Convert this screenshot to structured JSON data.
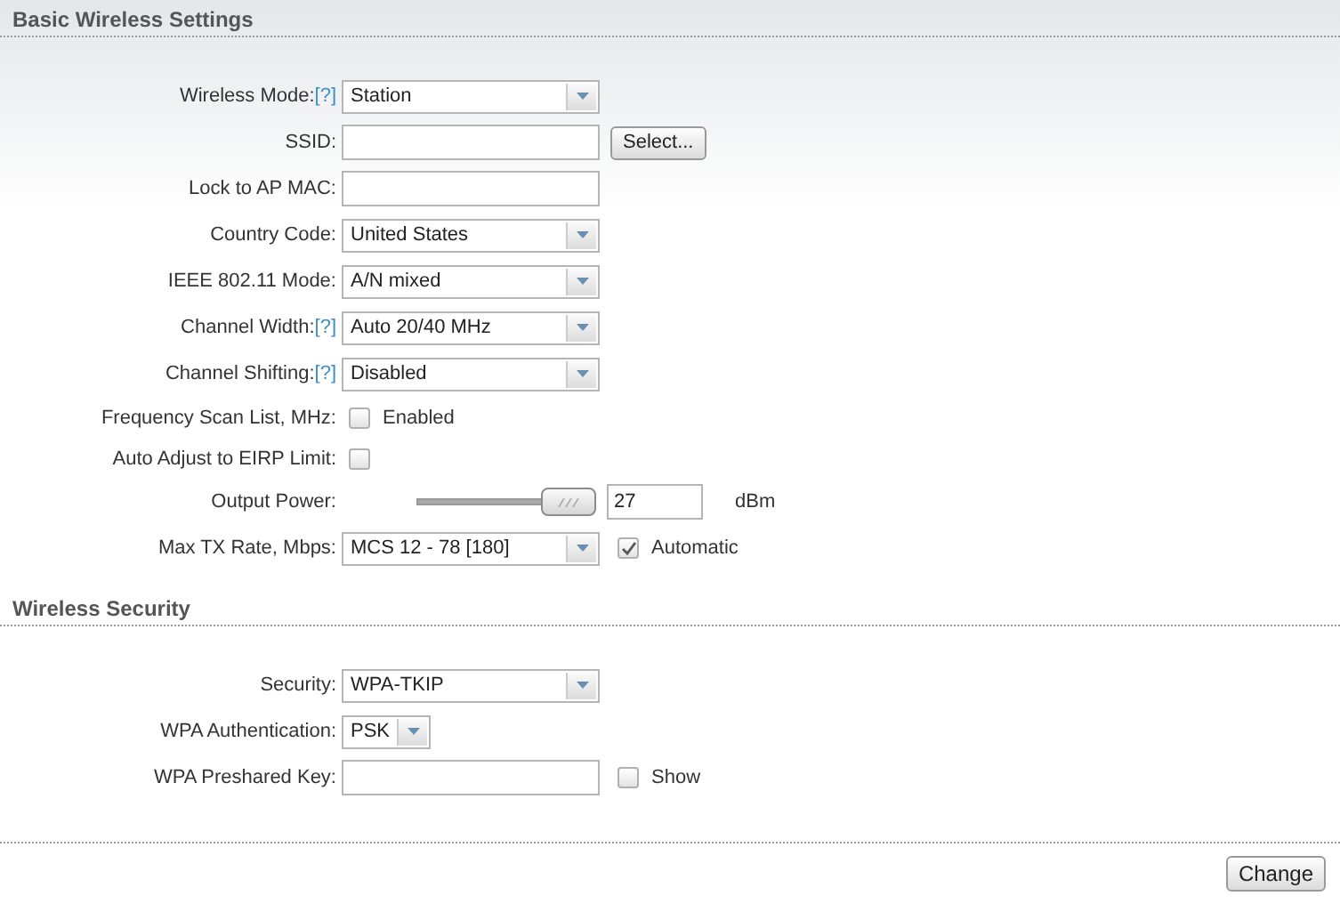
{
  "sections": [
    {
      "title": "Basic Wireless Settings",
      "rows": [
        {
          "kind": "select",
          "label": "Wireless Mode:",
          "help": "[?]",
          "value": "Station"
        },
        {
          "kind": "text",
          "label": "SSID:",
          "button": "Select..."
        },
        {
          "kind": "text",
          "label": "Lock to AP MAC:"
        },
        {
          "kind": "select",
          "label": "Country Code:",
          "value": "United States"
        },
        {
          "kind": "select",
          "label": "IEEE 802.11 Mode:",
          "value": "A/N mixed"
        },
        {
          "kind": "select",
          "label": "Channel Width:",
          "help": "[?]",
          "value": "Auto 20/40 MHz"
        },
        {
          "kind": "select",
          "label": "Channel Shifting:",
          "help": "[?]",
          "value": "Disabled"
        },
        {
          "kind": "checkbox",
          "label": "Frequency Scan List, MHz:",
          "checked": false,
          "text": "Enabled"
        },
        {
          "kind": "checkbox",
          "label": "Auto Adjust to EIRP Limit:",
          "checked": false
        },
        {
          "kind": "slider",
          "label": "Output Power:",
          "level": 1,
          "value": "27",
          "unit": "dBm"
        },
        {
          "kind": "select",
          "label": "Max TX Rate, Mbps:",
          "value": "MCS 12 - 78 [180]",
          "check": {
            "checked": true,
            "text": "Automatic"
          }
        }
      ]
    },
    {
      "title": "Wireless Security",
      "rows": [
        {
          "kind": "select",
          "label": "Security:",
          "value": "WPA-TKIP"
        },
        {
          "kind": "short-select",
          "label": "WPA Authentication:",
          "value": "PSK"
        },
        {
          "kind": "text",
          "label": "WPA Preshared Key:",
          "check": {
            "checked": false,
            "text": "Show"
          }
        }
      ]
    }
  ],
  "submit": "Change"
}
